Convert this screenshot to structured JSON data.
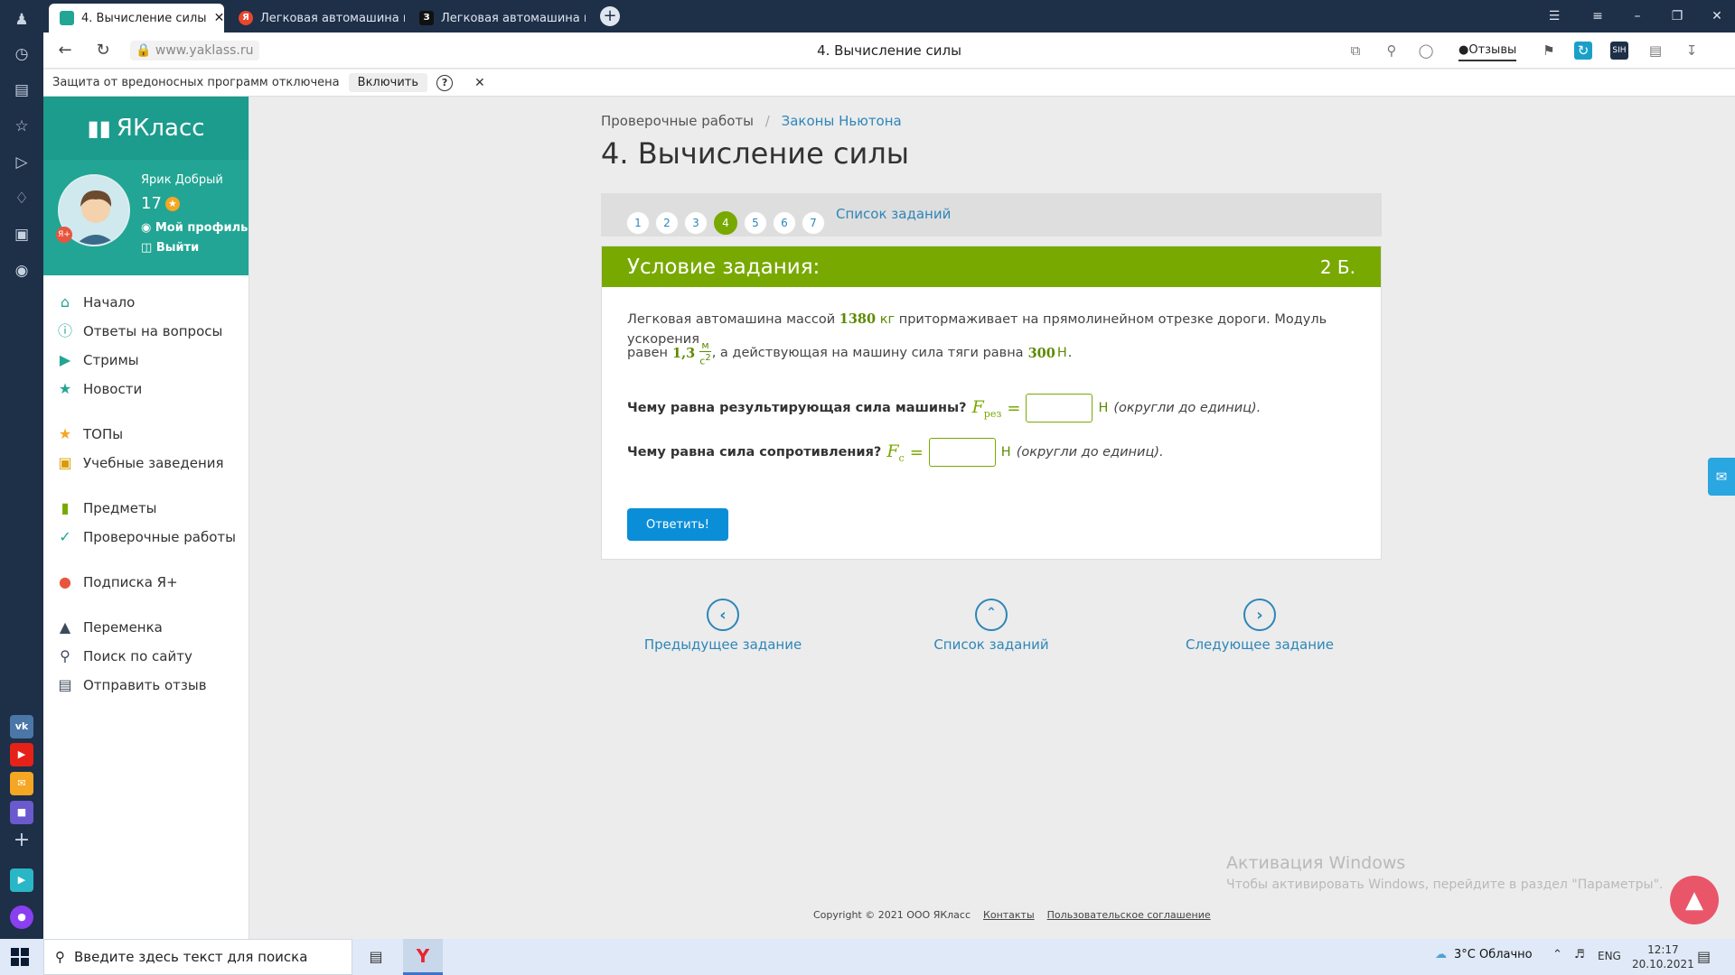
{
  "browser": {
    "tabs": [
      {
        "label": "4. Вычисление силы",
        "active": true
      },
      {
        "label": "Легковая автомашина ма",
        "active": false
      },
      {
        "label": "Легковая автомашина ма",
        "active": false
      }
    ],
    "url": "www.yaklass.ru",
    "page_title": "4. Вычисление силы",
    "feedback_label": "Отзывы",
    "protection_text": "Защита от вредоносных программ отключена",
    "protection_enable": "Включить",
    "new_tab": "+"
  },
  "site": {
    "logo": "ЯКласс",
    "user": {
      "name": "Ярик Добрый",
      "level": "17",
      "profile_link": "Мой профиль",
      "logout_link": "Выйти"
    },
    "menu": [
      {
        "label": "Начало",
        "icon": "home-icon"
      },
      {
        "label": "Ответы на вопросы",
        "icon": "question-icon"
      },
      {
        "label": "Стримы",
        "icon": "stream-icon"
      },
      {
        "label": "Новости",
        "icon": "news-icon"
      },
      {
        "label": "ТОПы",
        "icon": "star-icon"
      },
      {
        "label": "Учебные заведения",
        "icon": "school-icon"
      },
      {
        "label": "Предметы",
        "icon": "book-icon"
      },
      {
        "label": "Проверочные работы",
        "icon": "check-icon"
      },
      {
        "label": "Подписка Я+",
        "icon": "subscription-icon"
      },
      {
        "label": "Переменка",
        "icon": "bell-icon"
      },
      {
        "label": "Поиск по сайту",
        "icon": "search-icon"
      },
      {
        "label": "Отправить отзыв",
        "icon": "comment-icon"
      }
    ]
  },
  "main": {
    "breadcrumb": {
      "parent": "Проверочные работы",
      "separator": "/",
      "current": "Законы Ньютона"
    },
    "title": "4. Вычисление силы",
    "pagination": {
      "pages": [
        "1",
        "2",
        "3",
        "4",
        "5",
        "6",
        "7"
      ],
      "current": "4",
      "list_link": "Список заданий"
    },
    "task": {
      "header": "Условие задания:",
      "points": "2 Б.",
      "text_1": "Легковая автомашина массой",
      "mass": "1380",
      "mass_unit": "кг",
      "text_2": "притормаживает на прямолинейном отрезке дороги. Модуль ускорения",
      "text_3": "равен",
      "accel": "1,3",
      "frac_num": "м",
      "frac_den": "с",
      "frac_exp": "2",
      "text_4": ", а действующая на машину сила тяги равна",
      "force": "300",
      "force_unit": "Н",
      "q1": "Чему равна результирующая сила машины?",
      "q1_var": "F",
      "q1_sub": "рез",
      "q2": "Чему равна сила сопротивления?",
      "q2_var": "F",
      "q2_sub": "c",
      "eq": "=",
      "unit": "Н",
      "hint": "(округли до единиц).",
      "answer_button": "Ответить!"
    },
    "nav": {
      "prev": "Предыдущее задание",
      "list": "Список заданий",
      "next": "Следующее задание"
    },
    "footer": {
      "copyright": "Copyright © 2021 ООО ЯКласс",
      "contacts": "Контакты",
      "agreement": "Пользовательское соглашение"
    },
    "watermark": {
      "title": "Активация Windows",
      "subtitle": "Чтобы активировать Windows, перейдите в раздел \"Параметры\"."
    }
  },
  "taskbar": {
    "search_placeholder": "Введите здесь текст для поиска",
    "weather": "3°С  Облачно",
    "lang": "ENG",
    "time": "12:17",
    "date": "20.10.2021"
  },
  "colors": {
    "accent_green": "#78a900",
    "teal": "#22a594",
    "link_blue": "#2e86b8",
    "browser_dark": "#1e2f48"
  }
}
